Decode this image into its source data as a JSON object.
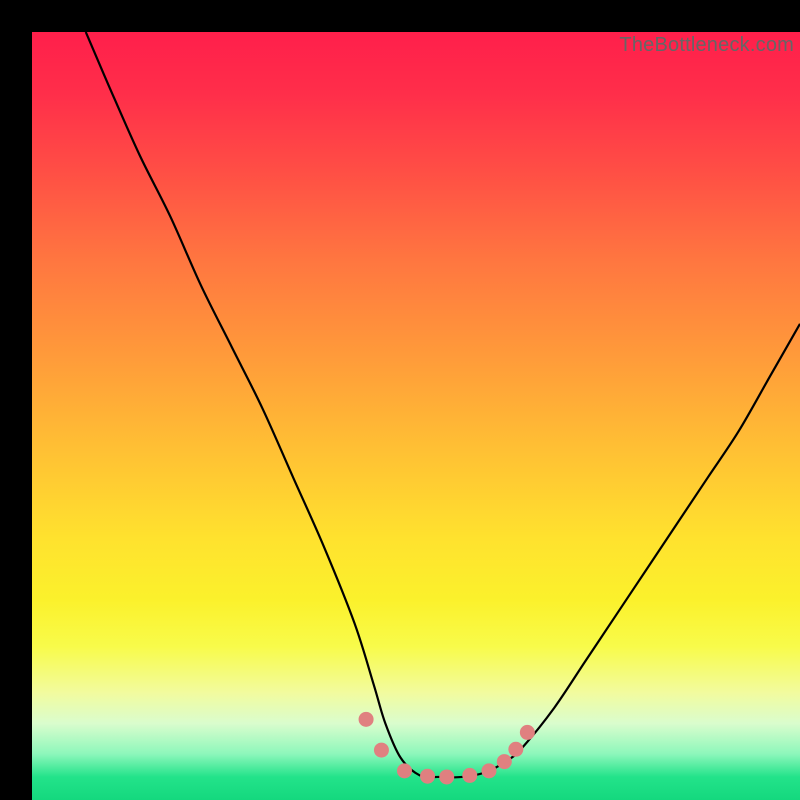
{
  "watermark": {
    "text": "TheBottleneck.com"
  },
  "chart_data": {
    "type": "line",
    "title": "",
    "xlabel": "",
    "ylabel": "",
    "xlim": [
      0,
      100
    ],
    "ylim": [
      0,
      100
    ],
    "grid": false,
    "series": [
      {
        "name": "bottleneck-curve",
        "color": "#000000",
        "x": [
          7,
          10,
          14,
          18,
          22,
          26,
          30,
          34,
          38,
          42,
          44.5,
          46,
          48,
          50.5,
          53,
          56,
          59,
          62,
          64,
          68,
          72,
          76,
          80,
          84,
          88,
          92,
          96,
          100
        ],
        "y": [
          100,
          93,
          84,
          76,
          67,
          59,
          51,
          42,
          33,
          23,
          15,
          10,
          5.5,
          3.2,
          3.0,
          3.0,
          3.6,
          5.2,
          7,
          12,
          18,
          24,
          30,
          36,
          42,
          48,
          55,
          62
        ]
      },
      {
        "name": "marker-dots",
        "color": "#e08080",
        "type": "scatter",
        "x": [
          43.5,
          45.5,
          48.5,
          51.5,
          54,
          57,
          59.5,
          61.5,
          63,
          64.5
        ],
        "y": [
          10.5,
          6.5,
          3.8,
          3.1,
          3.0,
          3.2,
          3.8,
          5.0,
          6.6,
          8.8
        ]
      }
    ]
  }
}
